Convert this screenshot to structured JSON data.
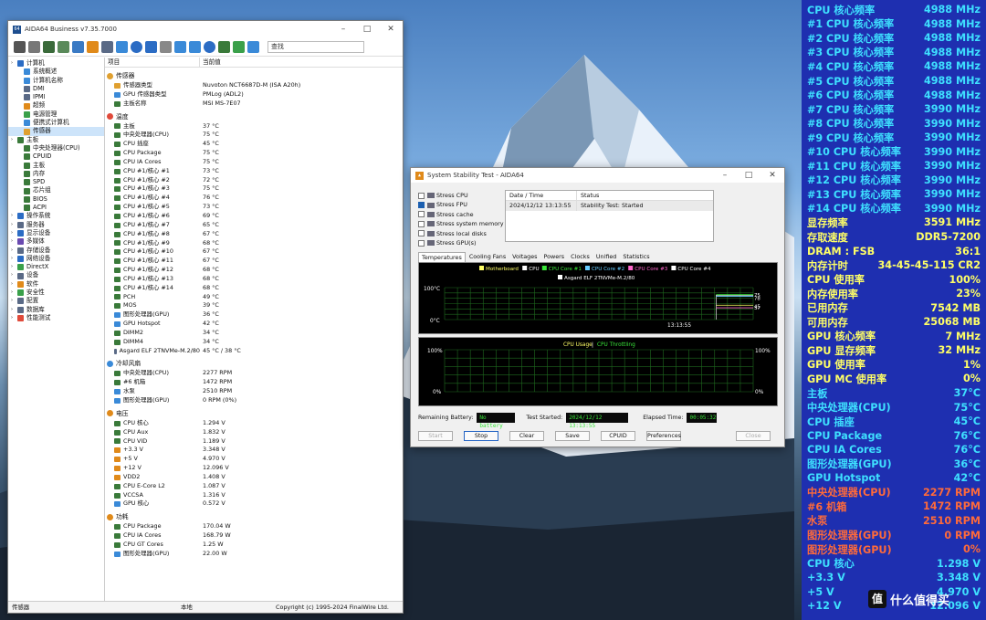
{
  "main": {
    "title": "AIDA64 Business v7.35.7000",
    "search_placeholder": "查找",
    "header": {
      "item": "项目",
      "value": "当前值"
    },
    "tree": [
      {
        "label": "计算机",
        "indent": 0,
        "color": "#2b6cc4"
      },
      {
        "label": "系统概述",
        "indent": 2,
        "color": "#3a8ad8"
      },
      {
        "label": "计算机名称",
        "indent": 2,
        "color": "#3a8ad8"
      },
      {
        "label": "DMI",
        "indent": 2,
        "color": "#5a6a86"
      },
      {
        "label": "IPMI",
        "indent": 2,
        "color": "#5a6a86"
      },
      {
        "label": "超频",
        "indent": 2,
        "color": "#e08a1a"
      },
      {
        "label": "电源管理",
        "indent": 2,
        "color": "#3aa04a"
      },
      {
        "label": "便携式计算机",
        "indent": 2,
        "color": "#3a8ad8"
      },
      {
        "label": "传感器",
        "indent": 2,
        "color": "#e0a030",
        "selected": true
      },
      {
        "label": "主板",
        "indent": 0,
        "color": "#3a7a3a"
      },
      {
        "label": "中央处理器(CPU)",
        "indent": 2,
        "color": "#3a7a3a"
      },
      {
        "label": "CPUID",
        "indent": 2,
        "color": "#3a7a3a"
      },
      {
        "label": "主板",
        "indent": 2,
        "color": "#3a7a3a"
      },
      {
        "label": "内存",
        "indent": 2,
        "color": "#3a7a3a"
      },
      {
        "label": "SPD",
        "indent": 2,
        "color": "#3a7a3a"
      },
      {
        "label": "芯片组",
        "indent": 2,
        "color": "#3a7a3a"
      },
      {
        "label": "BIOS",
        "indent": 2,
        "color": "#3a7a3a"
      },
      {
        "label": "ACPI",
        "indent": 2,
        "color": "#3a7a3a"
      },
      {
        "label": "操作系统",
        "indent": 0,
        "color": "#2b6cc4"
      },
      {
        "label": "服务器",
        "indent": 0,
        "color": "#5a6a86"
      },
      {
        "label": "显示设备",
        "indent": 0,
        "color": "#2b6cc4"
      },
      {
        "label": "多媒体",
        "indent": 0,
        "color": "#6a4ab0"
      },
      {
        "label": "存储设备",
        "indent": 0,
        "color": "#5a6a86"
      },
      {
        "label": "网络设备",
        "indent": 0,
        "color": "#2b6cc4"
      },
      {
        "label": "DirectX",
        "indent": 0,
        "color": "#3aa04a"
      },
      {
        "label": "设备",
        "indent": 0,
        "color": "#5a6a86"
      },
      {
        "label": "软件",
        "indent": 0,
        "color": "#e08a1a"
      },
      {
        "label": "安全性",
        "indent": 0,
        "color": "#3aa04a"
      },
      {
        "label": "配置",
        "indent": 0,
        "color": "#5a6a86"
      },
      {
        "label": "数据库",
        "indent": 0,
        "color": "#5a6a86"
      },
      {
        "label": "性能测试",
        "indent": 0,
        "color": "#e04a3a"
      }
    ],
    "sections": [
      {
        "title": "传感器",
        "color": "#e0a030",
        "rows": [
          {
            "k": "传感器类型",
            "v": "Nuvoton NCT6687D-M  (ISA A20h)",
            "c": "#e0a030"
          },
          {
            "k": "GPU 传感器类型",
            "v": "PMLog  (ADL2)",
            "c": "#3a8ad8"
          },
          {
            "k": "主板名称",
            "v": "MSI MS-7E07",
            "c": "#3a7a3a"
          }
        ]
      },
      {
        "title": "温度",
        "color": "#e04a3a",
        "rows": [
          {
            "k": "主板",
            "v": "37 °C",
            "c": "#3a7a3a"
          },
          {
            "k": "中央处理器(CPU)",
            "v": "75 °C",
            "c": "#3a7a3a"
          },
          {
            "k": "CPU 插座",
            "v": "45 °C",
            "c": "#3a7a3a"
          },
          {
            "k": "CPU Package",
            "v": "75 °C",
            "c": "#3a7a3a"
          },
          {
            "k": "CPU IA Cores",
            "v": "75 °C",
            "c": "#3a7a3a"
          },
          {
            "k": "CPU #1/核心 #1",
            "v": "73 °C",
            "c": "#3a7a3a"
          },
          {
            "k": "CPU #1/核心 #2",
            "v": "72 °C",
            "c": "#3a7a3a"
          },
          {
            "k": "CPU #1/核心 #3",
            "v": "75 °C",
            "c": "#3a7a3a"
          },
          {
            "k": "CPU #1/核心 #4",
            "v": "76 °C",
            "c": "#3a7a3a"
          },
          {
            "k": "CPU #1/核心 #5",
            "v": "73 °C",
            "c": "#3a7a3a"
          },
          {
            "k": "CPU #1/核心 #6",
            "v": "69 °C",
            "c": "#3a7a3a"
          },
          {
            "k": "CPU #1/核心 #7",
            "v": "65 °C",
            "c": "#3a7a3a"
          },
          {
            "k": "CPU #1/核心 #8",
            "v": "67 °C",
            "c": "#3a7a3a"
          },
          {
            "k": "CPU #1/核心 #9",
            "v": "68 °C",
            "c": "#3a7a3a"
          },
          {
            "k": "CPU #1/核心 #10",
            "v": "67 °C",
            "c": "#3a7a3a"
          },
          {
            "k": "CPU #1/核心 #11",
            "v": "67 °C",
            "c": "#3a7a3a"
          },
          {
            "k": "CPU #1/核心 #12",
            "v": "68 °C",
            "c": "#3a7a3a"
          },
          {
            "k": "CPU #1/核心 #13",
            "v": "68 °C",
            "c": "#3a7a3a"
          },
          {
            "k": "CPU #1/核心 #14",
            "v": "68 °C",
            "c": "#3a7a3a"
          },
          {
            "k": "PCH",
            "v": "49 °C",
            "c": "#3a7a3a"
          },
          {
            "k": "MOS",
            "v": "39 °C",
            "c": "#3a7a3a"
          },
          {
            "k": "图形处理器(GPU)",
            "v": "36 °C",
            "c": "#3a8ad8"
          },
          {
            "k": "GPU Hotspot",
            "v": "42 °C",
            "c": "#3a8ad8"
          },
          {
            "k": "DIMM2",
            "v": "34 °C",
            "c": "#3a7a3a"
          },
          {
            "k": "DIMM4",
            "v": "34 °C",
            "c": "#3a7a3a"
          },
          {
            "k": "Asgard ELF 2TNVMe-M.2/80",
            "v": "45 °C / 38 °C",
            "c": "#5a6a86"
          }
        ]
      },
      {
        "title": "冷却风扇",
        "color": "#3a8ad8",
        "rows": [
          {
            "k": "中央处理器(CPU)",
            "v": "2277 RPM",
            "c": "#3a7a3a"
          },
          {
            "k": "#6 机箱",
            "v": "1472 RPM",
            "c": "#3a7a3a"
          },
          {
            "k": "水泵",
            "v": "2510 RPM",
            "c": "#3a8ad8"
          },
          {
            "k": "图形处理器(GPU)",
            "v": "0 RPM  (0%)",
            "c": "#3a8ad8"
          }
        ]
      },
      {
        "title": "电压",
        "color": "#e08a1a",
        "rows": [
          {
            "k": "CPU 核心",
            "v": "1.294 V",
            "c": "#3a7a3a"
          },
          {
            "k": "CPU Aux",
            "v": "1.832 V",
            "c": "#3a7a3a"
          },
          {
            "k": "CPU VID",
            "v": "1.189 V",
            "c": "#3a7a3a"
          },
          {
            "k": "+3.3 V",
            "v": "3.348 V",
            "c": "#e08a1a"
          },
          {
            "k": "+5 V",
            "v": "4.970 V",
            "c": "#e08a1a"
          },
          {
            "k": "+12 V",
            "v": "12.096 V",
            "c": "#e08a1a"
          },
          {
            "k": "VDD2",
            "v": "1.408 V",
            "c": "#e08a1a"
          },
          {
            "k": "CPU E-Core L2",
            "v": "1.087 V",
            "c": "#3a7a3a"
          },
          {
            "k": "VCCSA",
            "v": "1.316 V",
            "c": "#3a7a3a"
          },
          {
            "k": "GPU 核心",
            "v": "0.572 V",
            "c": "#3a8ad8"
          }
        ]
      },
      {
        "title": "功耗",
        "color": "#e08a1a",
        "rows": [
          {
            "k": "CPU Package",
            "v": "170.04 W",
            "c": "#3a7a3a"
          },
          {
            "k": "CPU IA Cores",
            "v": "168.79 W",
            "c": "#3a7a3a"
          },
          {
            "k": "CPU GT Cores",
            "v": "1.25 W",
            "c": "#3a7a3a"
          },
          {
            "k": "图形处理器(GPU)",
            "v": "22.00 W",
            "c": "#3a8ad8"
          }
        ]
      }
    ],
    "status": {
      "left": "传感器",
      "mid": "本地",
      "right": "Copyright (c) 1995-2024 FinalWire Ltd."
    }
  },
  "stab": {
    "title": "System Stability Test - AIDA64",
    "stress": [
      {
        "label": "Stress CPU",
        "checked": false
      },
      {
        "label": "Stress FPU",
        "checked": true
      },
      {
        "label": "Stress cache",
        "checked": false
      },
      {
        "label": "Stress system memory",
        "checked": false
      },
      {
        "label": "Stress local disks",
        "checked": false
      },
      {
        "label": "Stress GPU(s)",
        "checked": false
      }
    ],
    "log_header": {
      "date": "Date / Time",
      "status": "Status"
    },
    "log_row": {
      "date": "2024/12/12 13:13:55",
      "status": "Stability Test: Started"
    },
    "tabs": [
      "Temperatures",
      "Cooling Fans",
      "Voltages",
      "Powers",
      "Clocks",
      "Unified",
      "Statistics"
    ],
    "graph1": {
      "legend": [
        "Motherboard",
        "CPU",
        "CPU Core #1",
        "CPU Core #2",
        "CPU Core #3",
        "CPU Core #4"
      ],
      "legend_colors": [
        "#ffff66",
        "#ffffff",
        "#39e639",
        "#66ccff",
        "#ff66cc",
        "#ffffff"
      ],
      "legend2": "Asgard ELF 2TNVMe-M.2/80",
      "ymax": "100°C",
      "ymin": "0°C",
      "time": "13:13:55",
      "right_labels": [
        "75",
        "78",
        "37",
        "45"
      ]
    },
    "graph2": {
      "title1": "CPU Usage",
      "title2": "CPU Throttling",
      "ymax": "100%",
      "ymin": "0%",
      "rmax": "100%",
      "rmin": "0%"
    },
    "battery_label": "Remaining Battery:",
    "battery": "No battery",
    "started_label": "Test Started:",
    "started": "2024/12/12 13:13:55",
    "elapsed_label": "Elapsed Time:",
    "elapsed": "00:05:32",
    "buttons": [
      "Start",
      "Stop",
      "Clear",
      "Save",
      "CPUID",
      "Preferences",
      "Close"
    ]
  },
  "osd": [
    {
      "l": "CPU 核心频率",
      "v": "4988 MHz",
      "c": "#3ee0ff"
    },
    {
      "l": "#1 CPU 核心频率",
      "v": "4988 MHz",
      "c": "#3ee0ff"
    },
    {
      "l": "#2 CPU 核心频率",
      "v": "4988 MHz",
      "c": "#3ee0ff"
    },
    {
      "l": "#3 CPU 核心频率",
      "v": "4988 MHz",
      "c": "#3ee0ff"
    },
    {
      "l": "#4 CPU 核心频率",
      "v": "4988 MHz",
      "c": "#3ee0ff"
    },
    {
      "l": "#5 CPU 核心频率",
      "v": "4988 MHz",
      "c": "#3ee0ff"
    },
    {
      "l": "#6 CPU 核心频率",
      "v": "4988 MHz",
      "c": "#3ee0ff"
    },
    {
      "l": "#7 CPU 核心频率",
      "v": "3990 MHz",
      "c": "#3ee0ff"
    },
    {
      "l": "#8 CPU 核心频率",
      "v": "3990 MHz",
      "c": "#3ee0ff"
    },
    {
      "l": "#9 CPU 核心频率",
      "v": "3990 MHz",
      "c": "#3ee0ff"
    },
    {
      "l": "#10 CPU 核心频率",
      "v": "3990 MHz",
      "c": "#3ee0ff"
    },
    {
      "l": "#11 CPU 核心频率",
      "v": "3990 MHz",
      "c": "#3ee0ff"
    },
    {
      "l": "#12 CPU 核心频率",
      "v": "3990 MHz",
      "c": "#3ee0ff"
    },
    {
      "l": "#13 CPU 核心频率",
      "v": "3990 MHz",
      "c": "#3ee0ff"
    },
    {
      "l": "#14 CPU 核心频率",
      "v": "3990 MHz",
      "c": "#3ee0ff"
    },
    {
      "l": "显存频率",
      "v": "3591 MHz",
      "c": "#ffff66"
    },
    {
      "l": "存取速度",
      "v": "DDR5-7200",
      "c": "#ffff66"
    },
    {
      "l": "DRAM : FSB",
      "v": "36:1",
      "c": "#ffff66"
    },
    {
      "l": "内存计时",
      "v": "34-45-45-115 CR2",
      "c": "#ffff66"
    },
    {
      "l": "CPU 使用率",
      "v": "100%",
      "c": "#ffff66"
    },
    {
      "l": "内存使用率",
      "v": "23%",
      "c": "#ffff66"
    },
    {
      "l": "已用内存",
      "v": "7542 MB",
      "c": "#ffff66"
    },
    {
      "l": "可用内存",
      "v": "25068 MB",
      "c": "#ffff66"
    },
    {
      "l": "GPU 核心频率",
      "v": "7 MHz",
      "c": "#ffff66"
    },
    {
      "l": "GPU 显存频率",
      "v": "32 MHz",
      "c": "#ffff66"
    },
    {
      "l": "GPU 使用率",
      "v": "1%",
      "c": "#ffff66"
    },
    {
      "l": "GPU MC 使用率",
      "v": "0%",
      "c": "#ffff66"
    },
    {
      "l": "主板",
      "v": "37°C",
      "c": "#3ee0ff"
    },
    {
      "l": "中央处理器(CPU)",
      "v": "75°C",
      "c": "#3ee0ff"
    },
    {
      "l": "CPU 插座",
      "v": "45°C",
      "c": "#3ee0ff"
    },
    {
      "l": "CPU Package",
      "v": "76°C",
      "c": "#3ee0ff"
    },
    {
      "l": "CPU IA Cores",
      "v": "76°C",
      "c": "#3ee0ff"
    },
    {
      "l": "图形处理器(GPU)",
      "v": "36°C",
      "c": "#3ee0ff"
    },
    {
      "l": "GPU Hotspot",
      "v": "42°C",
      "c": "#3ee0ff"
    },
    {
      "l": "中央处理器(CPU)",
      "v": "2277 RPM",
      "c": "#ff6a3a"
    },
    {
      "l": "#6 机箱",
      "v": "1472 RPM",
      "c": "#ff6a3a"
    },
    {
      "l": "水泵",
      "v": "2510 RPM",
      "c": "#ff6a3a"
    },
    {
      "l": "图形处理器(GPU)",
      "v": "0 RPM",
      "c": "#ff6a3a"
    },
    {
      "l": "图形处理器(GPU)",
      "v": "0%",
      "c": "#ff6a3a"
    },
    {
      "l": "CPU 核心",
      "v": "1.298 V",
      "c": "#3ee0ff"
    },
    {
      "l": "+3.3 V",
      "v": "3.348 V",
      "c": "#3ee0ff"
    },
    {
      "l": "+5 V",
      "v": "4.970 V",
      "c": "#3ee0ff"
    },
    {
      "l": "+12 V",
      "v": "12.096 V",
      "c": "#3ee0ff"
    }
  ],
  "watermark": {
    "logo": "值",
    "text": "什么值得买"
  }
}
